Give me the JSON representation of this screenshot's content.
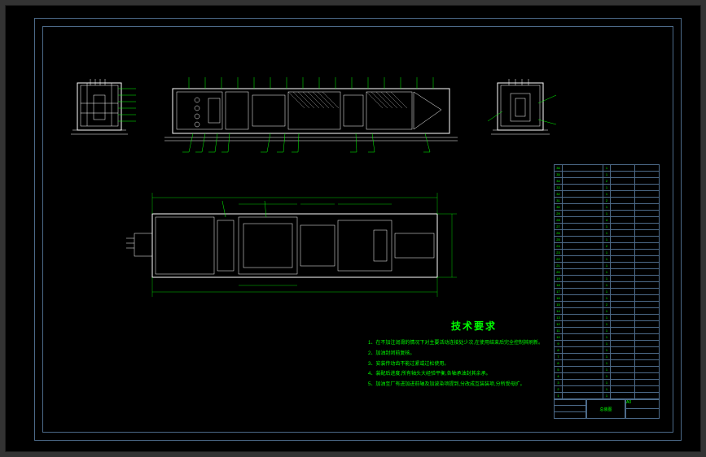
{
  "tech_req": {
    "title": "技术要求",
    "items": [
      "1、在不加注润滑的情况下对主要活动连接处少次,在使用结束后完全控制其刷新。",
      "2、加油封闭前复核。",
      "3、安装传动齿不能过紧或过松使用。",
      "4、装配后进度,所有轴头大经验平衡,各轴承油封其余承。",
      "5、加油至厂有进加进前轴及加波染项提到,分改成互装装项,分所受母扩。"
    ]
  },
  "title_block": {
    "drawing_name": "总装图",
    "drawing_no": "A0",
    "scale": "",
    "material": "",
    "designer": "",
    "checker": "",
    "date": ""
  },
  "parts_list": [
    {
      "no": "36",
      "name": "",
      "qty": "1",
      "mat": "",
      "note": ""
    },
    {
      "no": "35",
      "name": "",
      "qty": "1",
      "mat": "",
      "note": ""
    },
    {
      "no": "34",
      "name": "",
      "qty": "2",
      "mat": "",
      "note": ""
    },
    {
      "no": "33",
      "name": "",
      "qty": "1",
      "mat": "",
      "note": ""
    },
    {
      "no": "32",
      "name": "",
      "qty": "1",
      "mat": "",
      "note": ""
    },
    {
      "no": "31",
      "name": "",
      "qty": "2",
      "mat": "",
      "note": ""
    },
    {
      "no": "30",
      "name": "",
      "qty": "1",
      "mat": "",
      "note": ""
    },
    {
      "no": "29",
      "name": "",
      "qty": "1",
      "mat": "",
      "note": ""
    },
    {
      "no": "28",
      "name": "",
      "qty": "4",
      "mat": "",
      "note": ""
    },
    {
      "no": "27",
      "name": "",
      "qty": "1",
      "mat": "",
      "note": ""
    },
    {
      "no": "26",
      "name": "",
      "qty": "1",
      "mat": "",
      "note": ""
    },
    {
      "no": "25",
      "name": "",
      "qty": "1",
      "mat": "",
      "note": ""
    },
    {
      "no": "24",
      "name": "",
      "qty": "2",
      "mat": "",
      "note": ""
    },
    {
      "no": "23",
      "name": "",
      "qty": "1",
      "mat": "",
      "note": ""
    },
    {
      "no": "22",
      "name": "",
      "qty": "1",
      "mat": "",
      "note": ""
    },
    {
      "no": "21",
      "name": "",
      "qty": "1",
      "mat": "",
      "note": ""
    },
    {
      "no": "20",
      "name": "",
      "qty": "1",
      "mat": "",
      "note": ""
    },
    {
      "no": "19",
      "name": "",
      "qty": "1",
      "mat": "",
      "note": ""
    },
    {
      "no": "18",
      "name": "",
      "qty": "1",
      "mat": "",
      "note": ""
    },
    {
      "no": "17",
      "name": "",
      "qty": "1",
      "mat": "",
      "note": ""
    },
    {
      "no": "16",
      "name": "",
      "qty": "1",
      "mat": "",
      "note": ""
    },
    {
      "no": "15",
      "name": "",
      "qty": "2",
      "mat": "",
      "note": ""
    },
    {
      "no": "14",
      "name": "",
      "qty": "1",
      "mat": "",
      "note": ""
    },
    {
      "no": "13",
      "name": "",
      "qty": "1",
      "mat": "",
      "note": ""
    },
    {
      "no": "12",
      "name": "",
      "qty": "1",
      "mat": "",
      "note": ""
    },
    {
      "no": "11",
      "name": "",
      "qty": "1",
      "mat": "",
      "note": ""
    },
    {
      "no": "10",
      "name": "",
      "qty": "1",
      "mat": "",
      "note": ""
    },
    {
      "no": "9",
      "name": "",
      "qty": "1",
      "mat": "",
      "note": ""
    },
    {
      "no": "8",
      "name": "",
      "qty": "1",
      "mat": "",
      "note": ""
    },
    {
      "no": "7",
      "name": "",
      "qty": "1",
      "mat": "",
      "note": ""
    },
    {
      "no": "6",
      "name": "",
      "qty": "1",
      "mat": "",
      "note": ""
    },
    {
      "no": "5",
      "name": "",
      "qty": "1",
      "mat": "",
      "note": ""
    },
    {
      "no": "4",
      "name": "",
      "qty": "1",
      "mat": "",
      "note": ""
    },
    {
      "no": "3",
      "name": "",
      "qty": "1",
      "mat": "",
      "note": ""
    },
    {
      "no": "2",
      "name": "",
      "qty": "1",
      "mat": "",
      "note": ""
    },
    {
      "no": "1",
      "name": "",
      "qty": "1",
      "mat": "",
      "note": ""
    }
  ],
  "views": {
    "left_side": "left-side-view",
    "main_elevation": "main-elevation-view",
    "right_side": "right-side-view",
    "plan": "plan-view"
  }
}
